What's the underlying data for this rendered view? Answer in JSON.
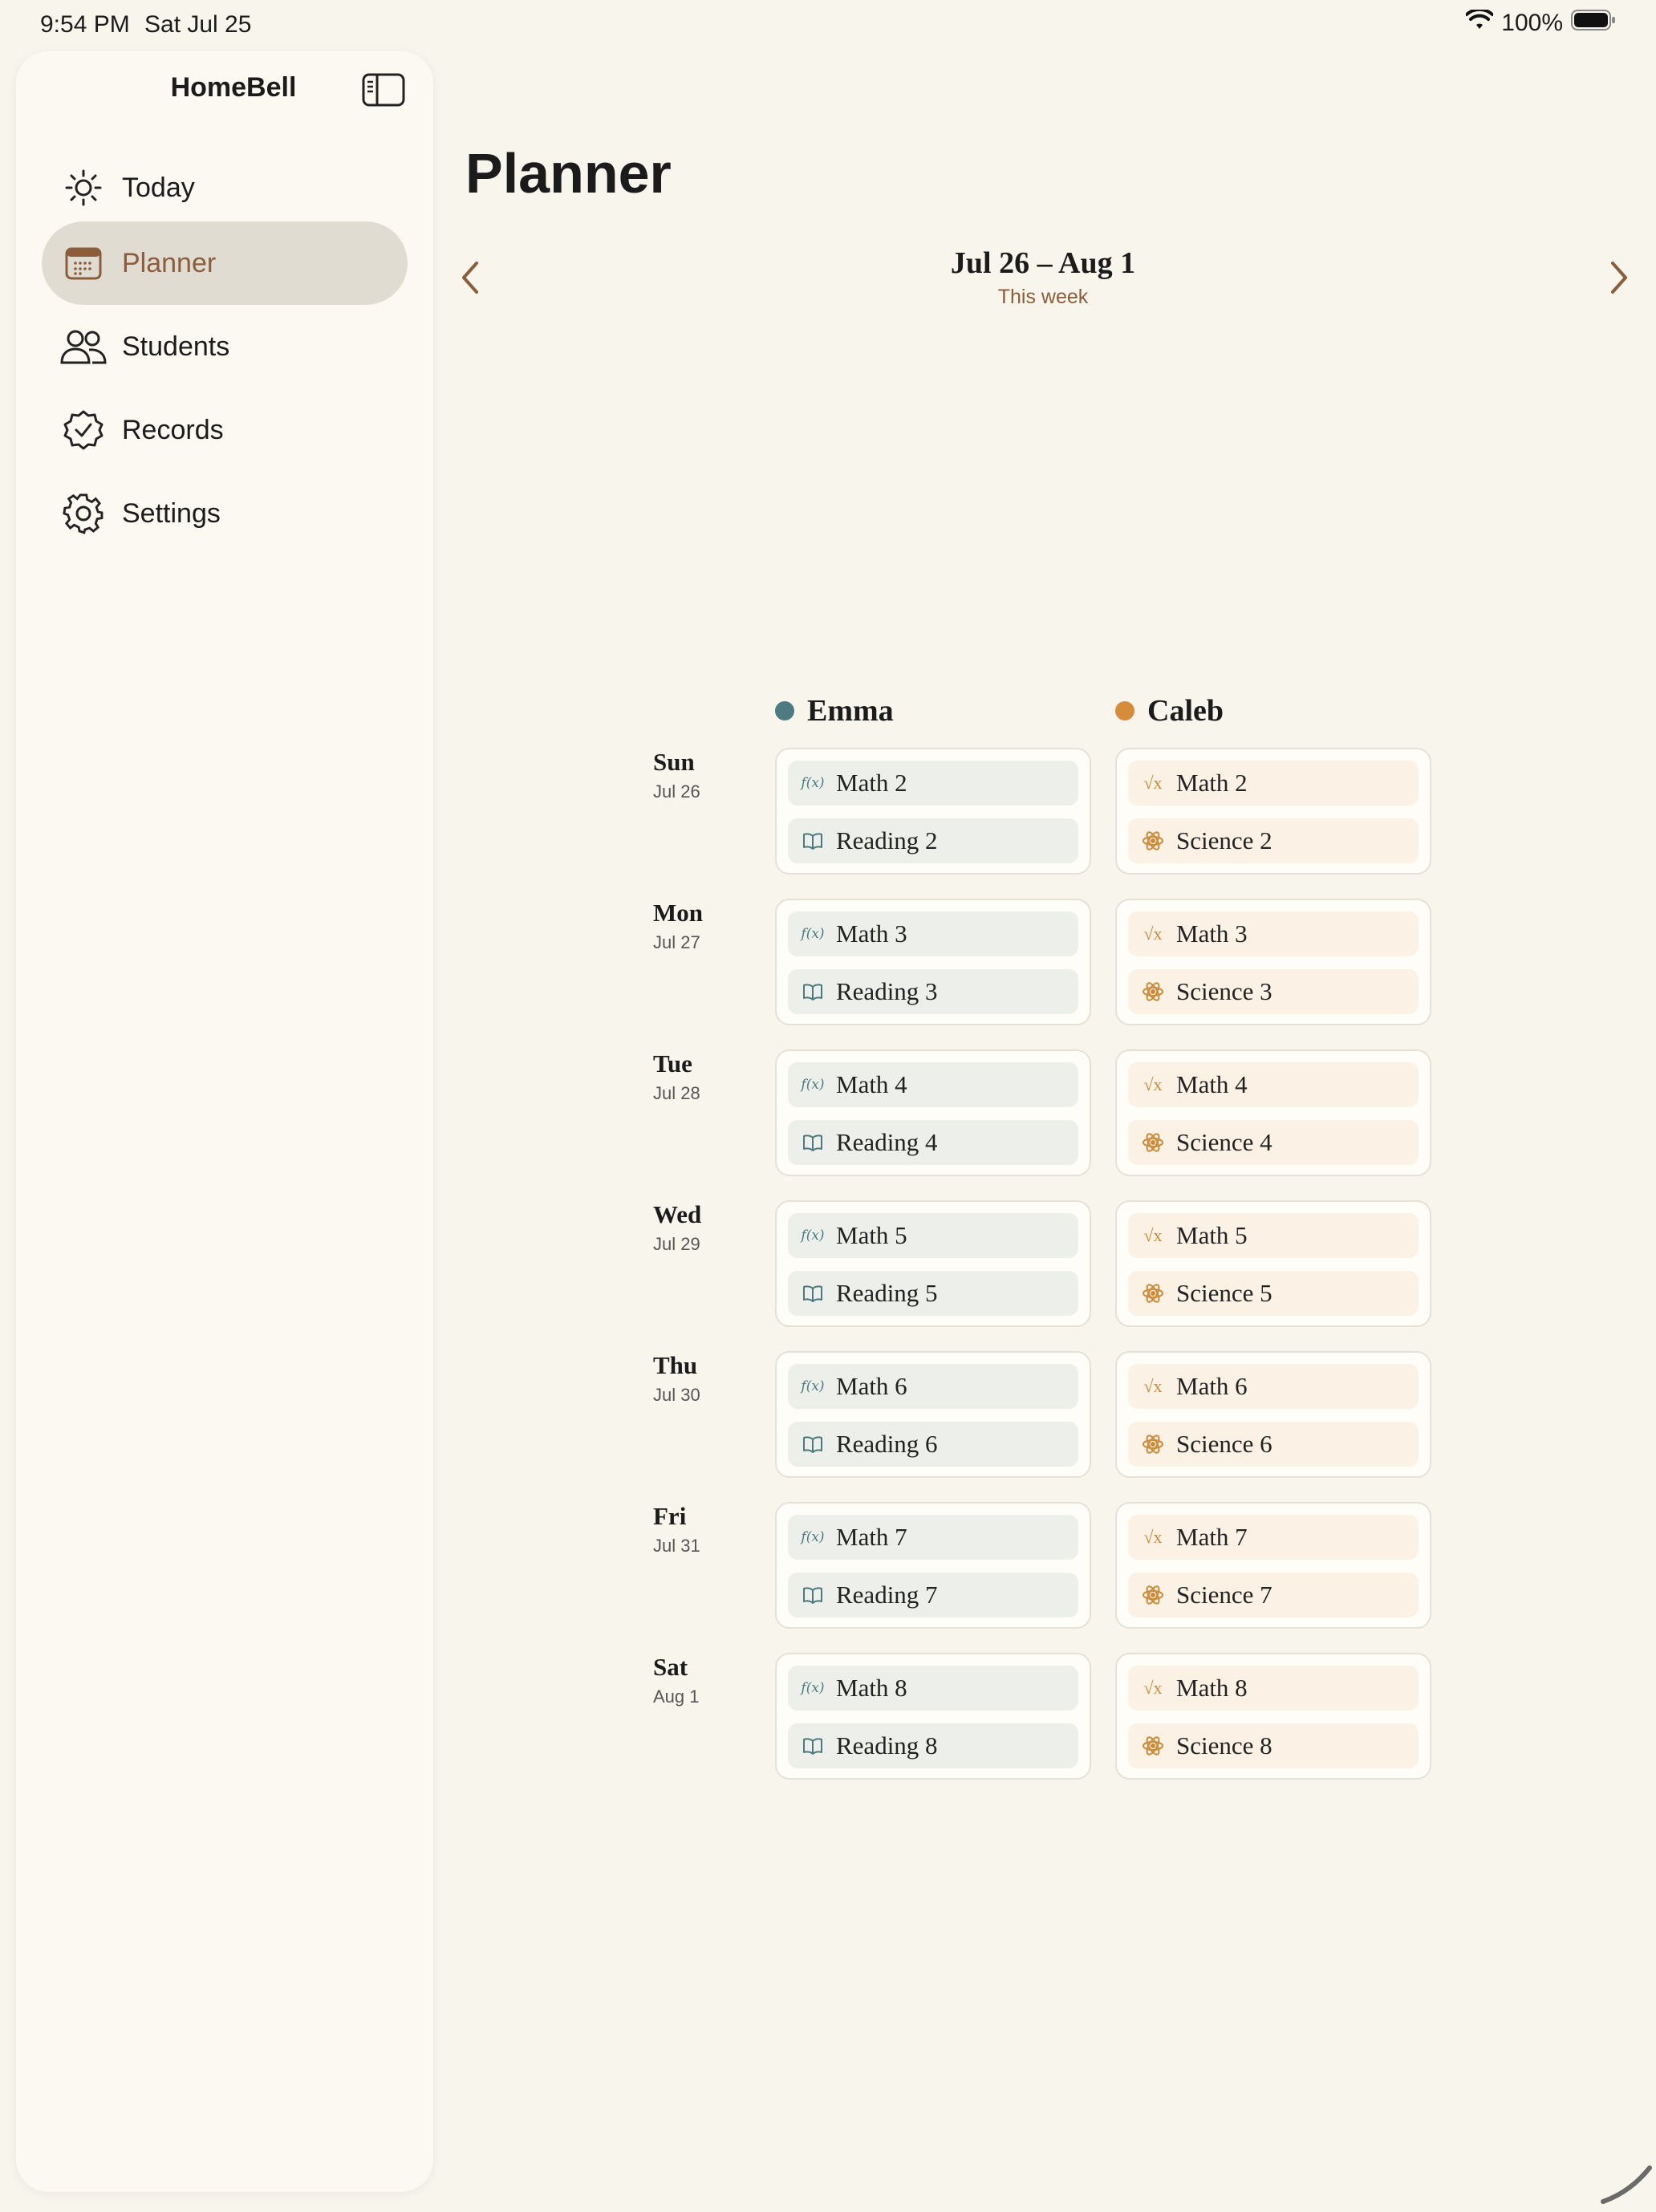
{
  "status": {
    "time": "9:54 PM",
    "date": "Sat Jul 25",
    "battery": "100%"
  },
  "sidebar": {
    "title": "HomeBell",
    "items": [
      {
        "label": "Today",
        "icon": "sun-icon",
        "active": false
      },
      {
        "label": "Planner",
        "icon": "calendar-icon",
        "active": true
      },
      {
        "label": "Students",
        "icon": "people-icon",
        "active": false
      },
      {
        "label": "Records",
        "icon": "checkmark-seal-icon",
        "active": false
      },
      {
        "label": "Settings",
        "icon": "gear-icon",
        "active": false
      }
    ]
  },
  "main": {
    "title": "Planner",
    "week": {
      "range": "Jul 26 – Aug 1",
      "subtitle": "This week"
    },
    "students": [
      {
        "name": "Emma",
        "color": "#4e7b82"
      },
      {
        "name": "Caleb",
        "color": "#d68d3b"
      }
    ],
    "days": [
      {
        "name": "Sun",
        "date": "Jul 26",
        "emma": [
          "Math 2",
          "Reading 2"
        ],
        "caleb": [
          "Math 2",
          "Science 2"
        ]
      },
      {
        "name": "Mon",
        "date": "Jul 27",
        "emma": [
          "Math 3",
          "Reading 3"
        ],
        "caleb": [
          "Math 3",
          "Science 3"
        ]
      },
      {
        "name": "Tue",
        "date": "Jul 28",
        "emma": [
          "Math 4",
          "Reading 4"
        ],
        "caleb": [
          "Math 4",
          "Science 4"
        ]
      },
      {
        "name": "Wed",
        "date": "Jul 29",
        "emma": [
          "Math 5",
          "Reading 5"
        ],
        "caleb": [
          "Math 5",
          "Science 5"
        ]
      },
      {
        "name": "Thu",
        "date": "Jul 30",
        "emma": [
          "Math 6",
          "Reading 6"
        ],
        "caleb": [
          "Math 6",
          "Science 6"
        ]
      },
      {
        "name": "Fri",
        "date": "Jul 31",
        "emma": [
          "Math 7",
          "Reading 7"
        ],
        "caleb": [
          "Math 7",
          "Science 7"
        ]
      },
      {
        "name": "Sat",
        "date": "Aug 1",
        "emma": [
          "Math 8",
          "Reading 8"
        ],
        "caleb": [
          "Math 8",
          "Science 8"
        ]
      }
    ],
    "icons": {
      "fx_glyph": "f(x)",
      "sqrt_glyph": "√x"
    }
  }
}
